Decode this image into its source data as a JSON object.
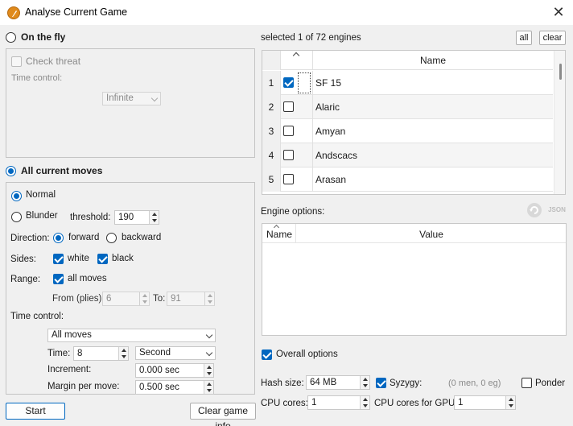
{
  "window": {
    "title": "Analyse Current Game",
    "close_glyph": "✕"
  },
  "left": {
    "on_the_fly": {
      "label": "On the fly",
      "check_threat": "Check threat",
      "time_control_label": "Time control:",
      "time_control_value": "Infinite"
    },
    "all_moves": {
      "label": "All current moves",
      "normal": "Normal",
      "blunder": "Blunder",
      "threshold_label": "threshold:",
      "threshold_value": "190",
      "direction_label": "Direction:",
      "forward": "forward",
      "backward": "backward",
      "sides_label": "Sides:",
      "white": "white",
      "black": "black",
      "range_label": "Range:",
      "all_moves_chk": "all moves",
      "from_label": "From (plies):",
      "from_value": "6",
      "to_label": "To:",
      "to_value": "91",
      "time_control_label": "Time control:",
      "tc_mode": "All moves",
      "time_label": "Time:",
      "time_value": "8",
      "time_unit": "Second",
      "increment_label": "Increment:",
      "increment_value": "0.000 sec",
      "margin_label": "Margin per move:",
      "margin_value": "0.500 sec"
    },
    "start_button": "Start",
    "clear_info_button": "Clear game info"
  },
  "right": {
    "engines_status": "selected 1 of 72 engines",
    "all_button": "all",
    "clear_button": "clear",
    "table": {
      "name_header": "Name",
      "rows": [
        {
          "num": "1",
          "name": "SF 15",
          "checked": true
        },
        {
          "num": "2",
          "name": "Alaric",
          "checked": false
        },
        {
          "num": "3",
          "name": "Amyan",
          "checked": false
        },
        {
          "num": "4",
          "name": "Andscacs",
          "checked": false
        },
        {
          "num": "5",
          "name": "Arasan",
          "checked": false
        }
      ]
    },
    "engine_options_label": "Engine options:",
    "json_label": "JSON",
    "options_table": {
      "name_header": "Name",
      "value_header": "Value"
    },
    "overall_options": "Overall options",
    "hash_label": "Hash size:",
    "hash_value": "64 MB",
    "syzygy_label": "Syzygy:",
    "syzygy_info": "(0 men, 0 eg)",
    "ponder_label": "Ponder",
    "cpu_label": "CPU cores:",
    "cpu_value": "1",
    "gpu_label": "CPU cores for GPU:",
    "gpu_value": "1"
  },
  "colors": {
    "accent": "#0067c0",
    "app_icon": "#e08a1c"
  }
}
